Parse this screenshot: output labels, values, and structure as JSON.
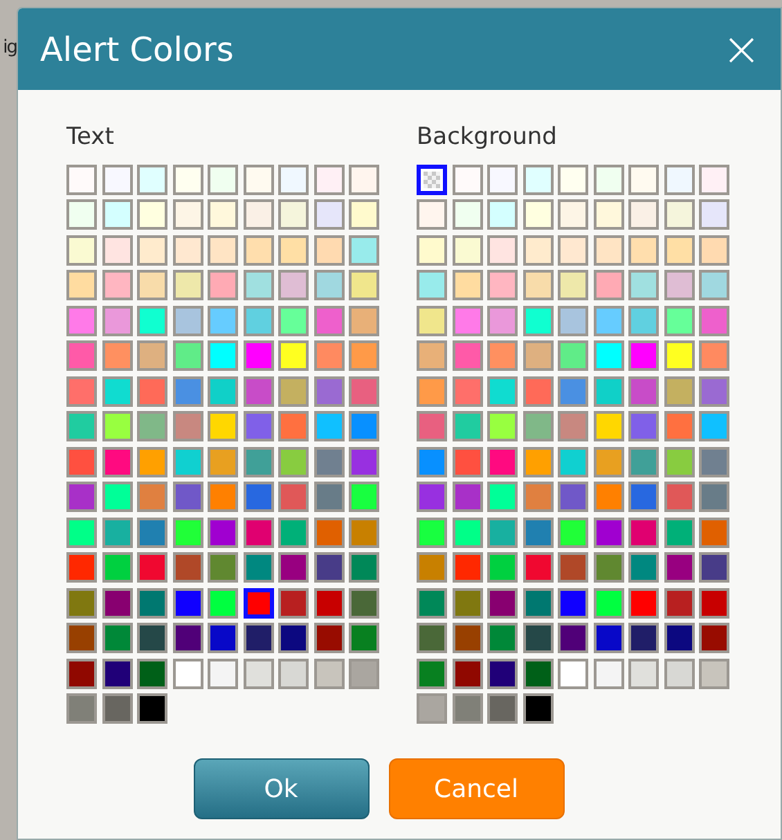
{
  "background_text": "ig",
  "dialog": {
    "title": "Alert Colors",
    "close_label": "×"
  },
  "palettes": [
    {
      "label": "Text",
      "swatches": [
        {
          "kind": "color",
          "color": "#fffafa",
          "selected": false
        },
        {
          "kind": "color",
          "color": "#f8f8ff",
          "selected": false
        },
        {
          "kind": "color",
          "color": "#e0ffff",
          "selected": false
        },
        {
          "kind": "color",
          "color": "#fffff0",
          "selected": false
        },
        {
          "kind": "color",
          "color": "#f0fff0",
          "selected": false
        },
        {
          "kind": "color",
          "color": "#fffaf0",
          "selected": false
        },
        {
          "kind": "color",
          "color": "#f0f8ff",
          "selected": false
        },
        {
          "kind": "color",
          "color": "#fff0f5",
          "selected": false
        },
        {
          "kind": "color",
          "color": "#fff5ee",
          "selected": false
        },
        {
          "kind": "color",
          "color": "#f0fff0",
          "selected": false
        },
        {
          "kind": "color",
          "color": "#d4ffff",
          "selected": false
        },
        {
          "kind": "color",
          "color": "#ffffe0",
          "selected": false
        },
        {
          "kind": "color",
          "color": "#fdf5e6",
          "selected": false
        },
        {
          "kind": "color",
          "color": "#fff8dc",
          "selected": false
        },
        {
          "kind": "color",
          "color": "#faf0e6",
          "selected": false
        },
        {
          "kind": "color",
          "color": "#f5f5dc",
          "selected": false
        },
        {
          "kind": "color",
          "color": "#e6e6fa",
          "selected": false
        },
        {
          "kind": "color",
          "color": "#fffacd",
          "selected": false
        },
        {
          "kind": "color",
          "color": "#fafad2",
          "selected": false
        },
        {
          "kind": "color",
          "color": "#ffe4e1",
          "selected": false
        },
        {
          "kind": "color",
          "color": "#ffebcd",
          "selected": false
        },
        {
          "kind": "color",
          "color": "#ffe8d0",
          "selected": false
        },
        {
          "kind": "color",
          "color": "#ffe4c4",
          "selected": false
        },
        {
          "kind": "color",
          "color": "#ffdead",
          "selected": false
        },
        {
          "kind": "color",
          "color": "#ffdfa5",
          "selected": false
        },
        {
          "kind": "color",
          "color": "#ffdab0",
          "selected": false
        },
        {
          "kind": "color",
          "color": "#98ebeb",
          "selected": false
        },
        {
          "kind": "color",
          "color": "#ffdca0",
          "selected": false
        },
        {
          "kind": "color",
          "color": "#ffb6c1",
          "selected": false
        },
        {
          "kind": "color",
          "color": "#f8dcaa",
          "selected": false
        },
        {
          "kind": "color",
          "color": "#eee8aa",
          "selected": false
        },
        {
          "kind": "color",
          "color": "#ffaab4",
          "selected": false
        },
        {
          "kind": "color",
          "color": "#a0e0e0",
          "selected": false
        },
        {
          "kind": "color",
          "color": "#dfbdd4",
          "selected": false
        },
        {
          "kind": "color",
          "color": "#a0d8e0",
          "selected": false
        },
        {
          "kind": "color",
          "color": "#f0e68c",
          "selected": false
        },
        {
          "kind": "color",
          "color": "#ff7ae8",
          "selected": false
        },
        {
          "kind": "color",
          "color": "#ea98da",
          "selected": false
        },
        {
          "kind": "color",
          "color": "#10ffd0",
          "selected": false
        },
        {
          "kind": "color",
          "color": "#a8c4de",
          "selected": false
        },
        {
          "kind": "color",
          "color": "#66ccff",
          "selected": false
        },
        {
          "kind": "color",
          "color": "#60d0e0",
          "selected": false
        },
        {
          "kind": "color",
          "color": "#66ff99",
          "selected": false
        },
        {
          "kind": "color",
          "color": "#ee60cc",
          "selected": false
        },
        {
          "kind": "color",
          "color": "#e8b078",
          "selected": false
        },
        {
          "kind": "color",
          "color": "#ff5aa8",
          "selected": false
        },
        {
          "kind": "color",
          "color": "#ff9060",
          "selected": false
        },
        {
          "kind": "color",
          "color": "#deb080",
          "selected": false
        },
        {
          "kind": "color",
          "color": "#60ec88",
          "selected": false
        },
        {
          "kind": "color",
          "color": "#00ffff",
          "selected": false
        },
        {
          "kind": "color",
          "color": "#ff00ff",
          "selected": false
        },
        {
          "kind": "color",
          "color": "#ffff20",
          "selected": false
        },
        {
          "kind": "color",
          "color": "#ff8a60",
          "selected": false
        },
        {
          "kind": "color",
          "color": "#ff9a48",
          "selected": false
        },
        {
          "kind": "color",
          "color": "#ff6f6a",
          "selected": false
        },
        {
          "kind": "color",
          "color": "#10dcd0",
          "selected": false
        },
        {
          "kind": "color",
          "color": "#ff6a58",
          "selected": false
        },
        {
          "kind": "color",
          "color": "#4a90e2",
          "selected": false
        },
        {
          "kind": "color",
          "color": "#10d0c8",
          "selected": false
        },
        {
          "kind": "color",
          "color": "#c84cc8",
          "selected": false
        },
        {
          "kind": "color",
          "color": "#c4b060",
          "selected": false
        },
        {
          "kind": "color",
          "color": "#9a6ad2",
          "selected": false
        },
        {
          "kind": "color",
          "color": "#e86080",
          "selected": false
        },
        {
          "kind": "color",
          "color": "#20cca0",
          "selected": false
        },
        {
          "kind": "color",
          "color": "#98ff40",
          "selected": false
        },
        {
          "kind": "color",
          "color": "#80b888",
          "selected": false
        },
        {
          "kind": "color",
          "color": "#c88880",
          "selected": false
        },
        {
          "kind": "color",
          "color": "#ffd700",
          "selected": false
        },
        {
          "kind": "color",
          "color": "#8060e8",
          "selected": false
        },
        {
          "kind": "color",
          "color": "#ff7040",
          "selected": false
        },
        {
          "kind": "color",
          "color": "#10c0ff",
          "selected": false
        },
        {
          "kind": "color",
          "color": "#0890ff",
          "selected": false
        },
        {
          "kind": "color",
          "color": "#ff5040",
          "selected": false
        },
        {
          "kind": "color",
          "color": "#ff0a80",
          "selected": false
        },
        {
          "kind": "color",
          "color": "#ffa000",
          "selected": false
        },
        {
          "kind": "color",
          "color": "#10d0d0",
          "selected": false
        },
        {
          "kind": "color",
          "color": "#e8a020",
          "selected": false
        },
        {
          "kind": "color",
          "color": "#40a098",
          "selected": false
        },
        {
          "kind": "color",
          "color": "#88cc40",
          "selected": false
        },
        {
          "kind": "color",
          "color": "#708090",
          "selected": false
        },
        {
          "kind": "color",
          "color": "#9830e0",
          "selected": false
        },
        {
          "kind": "color",
          "color": "#a830c8",
          "selected": false
        },
        {
          "kind": "color",
          "color": "#00ff98",
          "selected": false
        },
        {
          "kind": "color",
          "color": "#e08040",
          "selected": false
        },
        {
          "kind": "color",
          "color": "#7058c8",
          "selected": false
        },
        {
          "kind": "color",
          "color": "#ff8000",
          "selected": false
        },
        {
          "kind": "color",
          "color": "#2868e0",
          "selected": false
        },
        {
          "kind": "color",
          "color": "#e05858",
          "selected": false
        },
        {
          "kind": "color",
          "color": "#687c88",
          "selected": false
        },
        {
          "kind": "color",
          "color": "#18ff40",
          "selected": false
        },
        {
          "kind": "color",
          "color": "#00ff88",
          "selected": false
        },
        {
          "kind": "color",
          "color": "#18b0a0",
          "selected": false
        },
        {
          "kind": "color",
          "color": "#2080b0",
          "selected": false
        },
        {
          "kind": "color",
          "color": "#20ff38",
          "selected": false
        },
        {
          "kind": "color",
          "color": "#a000d0",
          "selected": false
        },
        {
          "kind": "color",
          "color": "#e00070",
          "selected": false
        },
        {
          "kind": "color",
          "color": "#00b078",
          "selected": false
        },
        {
          "kind": "color",
          "color": "#e06000",
          "selected": false
        },
        {
          "kind": "color",
          "color": "#c88000",
          "selected": false
        },
        {
          "kind": "color",
          "color": "#ff2800",
          "selected": false
        },
        {
          "kind": "color",
          "color": "#00d040",
          "selected": false
        },
        {
          "kind": "color",
          "color": "#f00830",
          "selected": false
        },
        {
          "kind": "color",
          "color": "#b04828",
          "selected": false
        },
        {
          "kind": "color",
          "color": "#608830",
          "selected": false
        },
        {
          "kind": "color",
          "color": "#008880",
          "selected": false
        },
        {
          "kind": "color",
          "color": "#980080",
          "selected": false
        },
        {
          "kind": "color",
          "color": "#483c88",
          "selected": false
        },
        {
          "kind": "color",
          "color": "#008858",
          "selected": false
        },
        {
          "kind": "color",
          "color": "#807810",
          "selected": false
        },
        {
          "kind": "color",
          "color": "#880070",
          "selected": false
        },
        {
          "kind": "color",
          "color": "#007870",
          "selected": false
        },
        {
          "kind": "color",
          "color": "#1000ff",
          "selected": false
        },
        {
          "kind": "color",
          "color": "#00ff40",
          "selected": false
        },
        {
          "kind": "color",
          "color": "#ff0000",
          "selected": true
        },
        {
          "kind": "color",
          "color": "#b82020",
          "selected": false
        },
        {
          "kind": "color",
          "color": "#c80000",
          "selected": false
        },
        {
          "kind": "color",
          "color": "#4a6838",
          "selected": false
        },
        {
          "kind": "color",
          "color": "#984000",
          "selected": false
        },
        {
          "kind": "color",
          "color": "#008838",
          "selected": false
        },
        {
          "kind": "color",
          "color": "#254848",
          "selected": false
        },
        {
          "kind": "color",
          "color": "#500078",
          "selected": false
        },
        {
          "kind": "color",
          "color": "#0808c8",
          "selected": false
        },
        {
          "kind": "color",
          "color": "#201e68",
          "selected": false
        },
        {
          "kind": "color",
          "color": "#0c0880",
          "selected": false
        },
        {
          "kind": "color",
          "color": "#980c00",
          "selected": false
        },
        {
          "kind": "color",
          "color": "#088020",
          "selected": false
        },
        {
          "kind": "color",
          "color": "#900800",
          "selected": false
        },
        {
          "kind": "color",
          "color": "#200078",
          "selected": false
        },
        {
          "kind": "color",
          "color": "#006018",
          "selected": false
        },
        {
          "kind": "color",
          "color": "#ffffff",
          "selected": false
        },
        {
          "kind": "color",
          "color": "#f4f4f4",
          "selected": false
        },
        {
          "kind": "color",
          "color": "#e0e0dc",
          "selected": false
        },
        {
          "kind": "color",
          "color": "#d8d8d4",
          "selected": false
        },
        {
          "kind": "color",
          "color": "#c8c4bc",
          "selected": false
        },
        {
          "kind": "color",
          "color": "#aaa6a0",
          "selected": false
        },
        {
          "kind": "color",
          "color": "#808078",
          "selected": false
        },
        {
          "kind": "color",
          "color": "#686660",
          "selected": false
        },
        {
          "kind": "color",
          "color": "#000000",
          "selected": false
        }
      ]
    },
    {
      "label": "Background",
      "swatches": [
        {
          "kind": "transparent",
          "selected": true
        },
        {
          "kind": "color",
          "color": "#fffafa",
          "selected": false
        },
        {
          "kind": "color",
          "color": "#f8f8ff",
          "selected": false
        },
        {
          "kind": "color",
          "color": "#e0ffff",
          "selected": false
        },
        {
          "kind": "color",
          "color": "#fffff0",
          "selected": false
        },
        {
          "kind": "color",
          "color": "#f0fff0",
          "selected": false
        },
        {
          "kind": "color",
          "color": "#fffaf0",
          "selected": false
        },
        {
          "kind": "color",
          "color": "#f0f8ff",
          "selected": false
        },
        {
          "kind": "color",
          "color": "#fff0f5",
          "selected": false
        },
        {
          "kind": "color",
          "color": "#fff5ee",
          "selected": false
        },
        {
          "kind": "color",
          "color": "#f0fff0",
          "selected": false
        },
        {
          "kind": "color",
          "color": "#d4ffff",
          "selected": false
        },
        {
          "kind": "color",
          "color": "#ffffe0",
          "selected": false
        },
        {
          "kind": "color",
          "color": "#fdf5e6",
          "selected": false
        },
        {
          "kind": "color",
          "color": "#fff8dc",
          "selected": false
        },
        {
          "kind": "color",
          "color": "#faf0e6",
          "selected": false
        },
        {
          "kind": "color",
          "color": "#f5f5dc",
          "selected": false
        },
        {
          "kind": "color",
          "color": "#e6e6fa",
          "selected": false
        },
        {
          "kind": "color",
          "color": "#fffacd",
          "selected": false
        },
        {
          "kind": "color",
          "color": "#fafad2",
          "selected": false
        },
        {
          "kind": "color",
          "color": "#ffe4e1",
          "selected": false
        },
        {
          "kind": "color",
          "color": "#ffebcd",
          "selected": false
        },
        {
          "kind": "color",
          "color": "#ffe8d0",
          "selected": false
        },
        {
          "kind": "color",
          "color": "#ffe4c4",
          "selected": false
        },
        {
          "kind": "color",
          "color": "#ffdead",
          "selected": false
        },
        {
          "kind": "color",
          "color": "#ffdfa5",
          "selected": false
        },
        {
          "kind": "color",
          "color": "#ffdab0",
          "selected": false
        },
        {
          "kind": "color",
          "color": "#98ebeb",
          "selected": false
        },
        {
          "kind": "color",
          "color": "#ffdca0",
          "selected": false
        },
        {
          "kind": "color",
          "color": "#ffb6c1",
          "selected": false
        },
        {
          "kind": "color",
          "color": "#f8dcaa",
          "selected": false
        },
        {
          "kind": "color",
          "color": "#eee8aa",
          "selected": false
        },
        {
          "kind": "color",
          "color": "#ffaab4",
          "selected": false
        },
        {
          "kind": "color",
          "color": "#a0e0e0",
          "selected": false
        },
        {
          "kind": "color",
          "color": "#dfbdd4",
          "selected": false
        },
        {
          "kind": "color",
          "color": "#a0d8e0",
          "selected": false
        },
        {
          "kind": "color",
          "color": "#f0e68c",
          "selected": false
        },
        {
          "kind": "color",
          "color": "#ff7ae8",
          "selected": false
        },
        {
          "kind": "color",
          "color": "#ea98da",
          "selected": false
        },
        {
          "kind": "color",
          "color": "#10ffd0",
          "selected": false
        },
        {
          "kind": "color",
          "color": "#a8c4de",
          "selected": false
        },
        {
          "kind": "color",
          "color": "#66ccff",
          "selected": false
        },
        {
          "kind": "color",
          "color": "#60d0e0",
          "selected": false
        },
        {
          "kind": "color",
          "color": "#66ff99",
          "selected": false
        },
        {
          "kind": "color",
          "color": "#ee60cc",
          "selected": false
        },
        {
          "kind": "color",
          "color": "#e8b078",
          "selected": false
        },
        {
          "kind": "color",
          "color": "#ff5aa8",
          "selected": false
        },
        {
          "kind": "color",
          "color": "#ff9060",
          "selected": false
        },
        {
          "kind": "color",
          "color": "#deb080",
          "selected": false
        },
        {
          "kind": "color",
          "color": "#60ec88",
          "selected": false
        },
        {
          "kind": "color",
          "color": "#00ffff",
          "selected": false
        },
        {
          "kind": "color",
          "color": "#ff00ff",
          "selected": false
        },
        {
          "kind": "color",
          "color": "#ffff20",
          "selected": false
        },
        {
          "kind": "color",
          "color": "#ff8a60",
          "selected": false
        },
        {
          "kind": "color",
          "color": "#ff9a48",
          "selected": false
        },
        {
          "kind": "color",
          "color": "#ff6f6a",
          "selected": false
        },
        {
          "kind": "color",
          "color": "#10dcd0",
          "selected": false
        },
        {
          "kind": "color",
          "color": "#ff6a58",
          "selected": false
        },
        {
          "kind": "color",
          "color": "#4a90e2",
          "selected": false
        },
        {
          "kind": "color",
          "color": "#10d0c8",
          "selected": false
        },
        {
          "kind": "color",
          "color": "#c84cc8",
          "selected": false
        },
        {
          "kind": "color",
          "color": "#c4b060",
          "selected": false
        },
        {
          "kind": "color",
          "color": "#9a6ad2",
          "selected": false
        },
        {
          "kind": "color",
          "color": "#e86080",
          "selected": false
        },
        {
          "kind": "color",
          "color": "#20cca0",
          "selected": false
        },
        {
          "kind": "color",
          "color": "#98ff40",
          "selected": false
        },
        {
          "kind": "color",
          "color": "#80b888",
          "selected": false
        },
        {
          "kind": "color",
          "color": "#c88880",
          "selected": false
        },
        {
          "kind": "color",
          "color": "#ffd700",
          "selected": false
        },
        {
          "kind": "color",
          "color": "#8060e8",
          "selected": false
        },
        {
          "kind": "color",
          "color": "#ff7040",
          "selected": false
        },
        {
          "kind": "color",
          "color": "#10c0ff",
          "selected": false
        },
        {
          "kind": "color",
          "color": "#0890ff",
          "selected": false
        },
        {
          "kind": "color",
          "color": "#ff5040",
          "selected": false
        },
        {
          "kind": "color",
          "color": "#ff0a80",
          "selected": false
        },
        {
          "kind": "color",
          "color": "#ffa000",
          "selected": false
        },
        {
          "kind": "color",
          "color": "#10d0d0",
          "selected": false
        },
        {
          "kind": "color",
          "color": "#e8a020",
          "selected": false
        },
        {
          "kind": "color",
          "color": "#40a098",
          "selected": false
        },
        {
          "kind": "color",
          "color": "#88cc40",
          "selected": false
        },
        {
          "kind": "color",
          "color": "#708090",
          "selected": false
        },
        {
          "kind": "color",
          "color": "#9830e0",
          "selected": false
        },
        {
          "kind": "color",
          "color": "#a830c8",
          "selected": false
        },
        {
          "kind": "color",
          "color": "#00ff98",
          "selected": false
        },
        {
          "kind": "color",
          "color": "#e08040",
          "selected": false
        },
        {
          "kind": "color",
          "color": "#7058c8",
          "selected": false
        },
        {
          "kind": "color",
          "color": "#ff8000",
          "selected": false
        },
        {
          "kind": "color",
          "color": "#2868e0",
          "selected": false
        },
        {
          "kind": "color",
          "color": "#e05858",
          "selected": false
        },
        {
          "kind": "color",
          "color": "#687c88",
          "selected": false
        },
        {
          "kind": "color",
          "color": "#18ff40",
          "selected": false
        },
        {
          "kind": "color",
          "color": "#00ff88",
          "selected": false
        },
        {
          "kind": "color",
          "color": "#18b0a0",
          "selected": false
        },
        {
          "kind": "color",
          "color": "#2080b0",
          "selected": false
        },
        {
          "kind": "color",
          "color": "#20ff38",
          "selected": false
        },
        {
          "kind": "color",
          "color": "#a000d0",
          "selected": false
        },
        {
          "kind": "color",
          "color": "#e00070",
          "selected": false
        },
        {
          "kind": "color",
          "color": "#00b078",
          "selected": false
        },
        {
          "kind": "color",
          "color": "#e06000",
          "selected": false
        },
        {
          "kind": "color",
          "color": "#c88000",
          "selected": false
        },
        {
          "kind": "color",
          "color": "#ff2800",
          "selected": false
        },
        {
          "kind": "color",
          "color": "#00d040",
          "selected": false
        },
        {
          "kind": "color",
          "color": "#f00830",
          "selected": false
        },
        {
          "kind": "color",
          "color": "#b04828",
          "selected": false
        },
        {
          "kind": "color",
          "color": "#608830",
          "selected": false
        },
        {
          "kind": "color",
          "color": "#008880",
          "selected": false
        },
        {
          "kind": "color",
          "color": "#980080",
          "selected": false
        },
        {
          "kind": "color",
          "color": "#483c88",
          "selected": false
        },
        {
          "kind": "color",
          "color": "#008858",
          "selected": false
        },
        {
          "kind": "color",
          "color": "#807810",
          "selected": false
        },
        {
          "kind": "color",
          "color": "#880070",
          "selected": false
        },
        {
          "kind": "color",
          "color": "#007870",
          "selected": false
        },
        {
          "kind": "color",
          "color": "#1000ff",
          "selected": false
        },
        {
          "kind": "color",
          "color": "#00ff40",
          "selected": false
        },
        {
          "kind": "color",
          "color": "#ff0000",
          "selected": false
        },
        {
          "kind": "color",
          "color": "#b82020",
          "selected": false
        },
        {
          "kind": "color",
          "color": "#c80000",
          "selected": false
        },
        {
          "kind": "color",
          "color": "#4a6838",
          "selected": false
        },
        {
          "kind": "color",
          "color": "#984000",
          "selected": false
        },
        {
          "kind": "color",
          "color": "#008838",
          "selected": false
        },
        {
          "kind": "color",
          "color": "#254848",
          "selected": false
        },
        {
          "kind": "color",
          "color": "#500078",
          "selected": false
        },
        {
          "kind": "color",
          "color": "#0808c8",
          "selected": false
        },
        {
          "kind": "color",
          "color": "#201e68",
          "selected": false
        },
        {
          "kind": "color",
          "color": "#0c0880",
          "selected": false
        },
        {
          "kind": "color",
          "color": "#980c00",
          "selected": false
        },
        {
          "kind": "color",
          "color": "#088020",
          "selected": false
        },
        {
          "kind": "color",
          "color": "#900800",
          "selected": false
        },
        {
          "kind": "color",
          "color": "#200078",
          "selected": false
        },
        {
          "kind": "color",
          "color": "#006018",
          "selected": false
        },
        {
          "kind": "color",
          "color": "#ffffff",
          "selected": false
        },
        {
          "kind": "color",
          "color": "#f4f4f4",
          "selected": false
        },
        {
          "kind": "color",
          "color": "#e0e0dc",
          "selected": false
        },
        {
          "kind": "color",
          "color": "#d8d8d4",
          "selected": false
        },
        {
          "kind": "color",
          "color": "#c8c4bc",
          "selected": false
        },
        {
          "kind": "color",
          "color": "#aaa6a0",
          "selected": false
        },
        {
          "kind": "color",
          "color": "#808078",
          "selected": false
        },
        {
          "kind": "color",
          "color": "#686660",
          "selected": false
        },
        {
          "kind": "color",
          "color": "#000000",
          "selected": false
        }
      ]
    }
  ],
  "buttons": [
    {
      "label": "Ok",
      "kind": "primary"
    },
    {
      "label": "Cancel",
      "kind": "secondary"
    }
  ]
}
